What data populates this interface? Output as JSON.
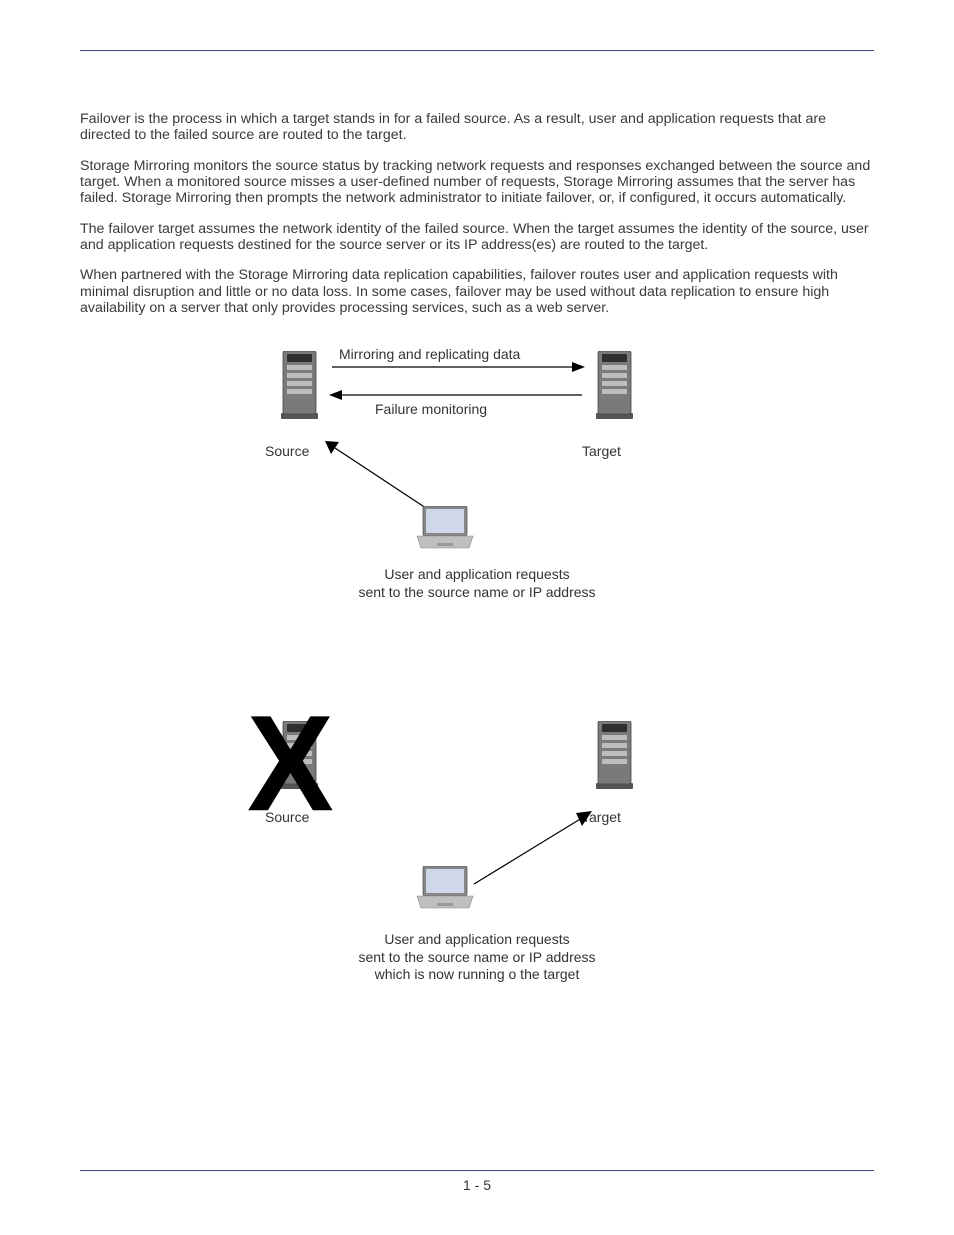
{
  "paragraphs": {
    "p1": "Failover is the process in which a target stands in for a failed source. As a result, user and application requests that are directed to the failed source are routed to the target.",
    "p2": "Storage Mirroring monitors the source status by tracking network requests and responses exchanged between the source and target. When a monitored source misses a user-defined number of requests, Storage Mirroring assumes that the server has failed. Storage Mirroring then prompts the network administrator to initiate failover, or, if configured, it occurs automatically.",
    "p3": "The failover target assumes the network identity of the failed source. When the target assumes the identity of the source, user and application requests destined for the source server or its IP address(es) are routed to the target.",
    "p4": "When partnered with the Storage Mirroring data replication capabilities, failover routes user and application requests with minimal disruption and little or no data loss. In some cases, failover may be used without data replication to ensure high availability on a server that only provides processing services, such as a web server."
  },
  "diagram1": {
    "label_mirror": "Mirroring and replicating data",
    "label_monitor": "Failure monitoring",
    "label_source": "Source",
    "label_target": "Target",
    "caption_l1": "User and application requests",
    "caption_l2": "sent to the source name or IP address"
  },
  "diagram2": {
    "label_source": "Source",
    "label_target": "Target",
    "x_overlay": "X",
    "caption_l1": "User and application requests",
    "caption_l2": "sent to the source name or IP address",
    "caption_l3": "which is now running o the target"
  },
  "page_number": "1 - 5"
}
